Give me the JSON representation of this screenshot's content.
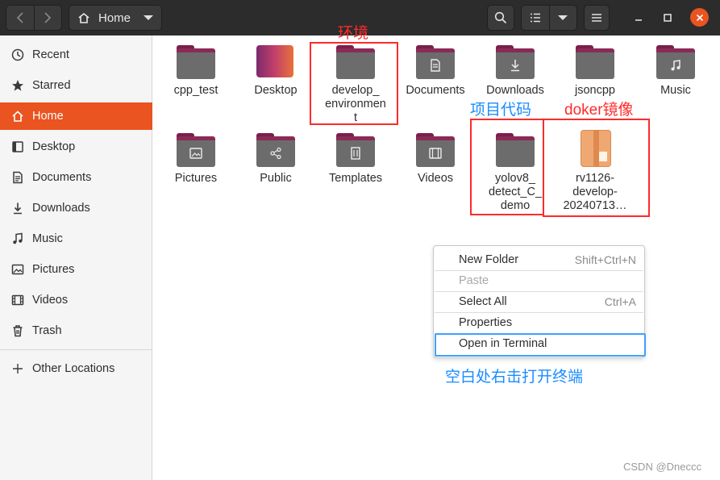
{
  "header": {
    "location_label": "Home",
    "icons": {
      "back": "chevron-left-icon",
      "forward": "chevron-right-icon",
      "home": "home-icon",
      "search": "search-icon",
      "list_view": "list-view-icon",
      "view_options": "chevron-down-icon",
      "menu": "hamburger-icon",
      "minimize": "minimize-icon",
      "maximize": "maximize-icon",
      "close": "close-icon"
    },
    "accent_color": "#e95420"
  },
  "sidebar": {
    "items": [
      {
        "label": "Recent",
        "icon": "clock-icon"
      },
      {
        "label": "Starred",
        "icon": "star-icon"
      },
      {
        "label": "Home",
        "icon": "home-icon",
        "active": true
      },
      {
        "label": "Desktop",
        "icon": "desktop-icon"
      },
      {
        "label": "Documents",
        "icon": "document-icon"
      },
      {
        "label": "Downloads",
        "icon": "download-icon"
      },
      {
        "label": "Music",
        "icon": "music-icon"
      },
      {
        "label": "Pictures",
        "icon": "picture-icon"
      },
      {
        "label": "Videos",
        "icon": "video-icon"
      },
      {
        "label": "Trash",
        "icon": "trash-icon"
      }
    ],
    "other_locations": "Other Locations"
  },
  "files": [
    {
      "name": "cpp_test",
      "type": "folder"
    },
    {
      "name": "Desktop",
      "type": "desktop"
    },
    {
      "name": "develop_\nenvironmen\nt",
      "type": "folder"
    },
    {
      "name": "Documents",
      "type": "folder-documents"
    },
    {
      "name": "Downloads",
      "type": "folder-downloads"
    },
    {
      "name": "jsoncpp",
      "type": "folder"
    },
    {
      "name": "Music",
      "type": "folder-music"
    },
    {
      "name": "Pictures",
      "type": "folder-pictures"
    },
    {
      "name": "Public",
      "type": "folder-public"
    },
    {
      "name": "Templates",
      "type": "folder-templates"
    },
    {
      "name": "Videos",
      "type": "folder-videos"
    },
    {
      "name": "yolov8_\ndetect_C_\ndemo",
      "type": "folder"
    },
    {
      "name": "rv1126-\ndevelop-\n20240713…",
      "type": "package"
    }
  ],
  "annotations": {
    "environment": "环境",
    "project_code": "项目代码",
    "docker_image": "doker镜像",
    "instruction": "空白处右击打开终端"
  },
  "context_menu": {
    "new_folder": {
      "label": "New Folder",
      "shortcut": "Shift+Ctrl+N"
    },
    "paste": {
      "label": "Paste",
      "disabled": true
    },
    "select_all": {
      "label": "Select All",
      "shortcut": "Ctrl+A"
    },
    "properties": {
      "label": "Properties"
    },
    "open_terminal": {
      "label": "Open in Terminal"
    }
  },
  "watermark": "CSDN @Dneccc"
}
